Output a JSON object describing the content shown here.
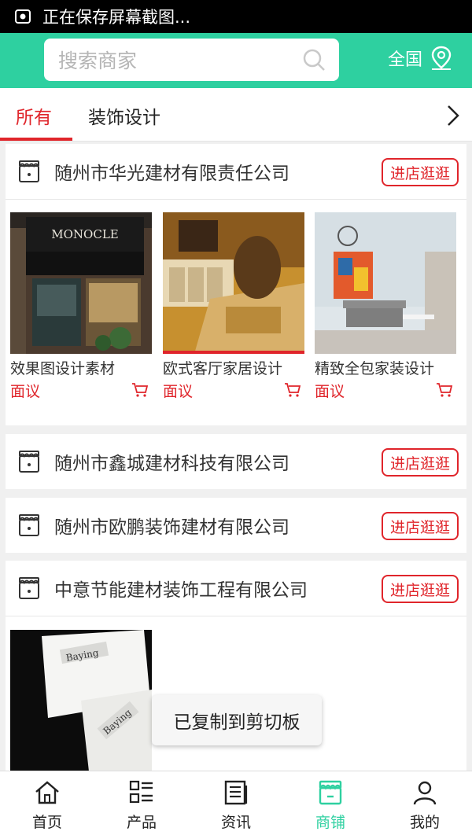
{
  "status_bar": {
    "text": "正在保存屏幕截图..."
  },
  "search": {
    "placeholder": "搜索商家"
  },
  "region": {
    "label": "全国"
  },
  "tabs": [
    {
      "label": "所有",
      "active": true
    },
    {
      "label": "装饰设计",
      "active": false
    }
  ],
  "shops": [
    {
      "name": "随州市华光建材有限责任公司",
      "visit_label": "进店逛逛",
      "products": [
        {
          "name": "效果图设计素材",
          "price": "面议",
          "image_text": "MONOCLE"
        },
        {
          "name": "欧式客厅家居设计",
          "price": "面议"
        },
        {
          "name": "精致全包家装设计",
          "price": "面议"
        }
      ]
    },
    {
      "name": "随州市鑫城建材科技有限公司",
      "visit_label": "进店逛逛"
    },
    {
      "name": "随州市欧鹏装饰建材有限公司",
      "visit_label": "进店逛逛"
    },
    {
      "name": "中意节能建材装饰工程有限公司",
      "visit_label": "进店逛逛",
      "products": [
        {
          "image_text": "Baying"
        }
      ]
    }
  ],
  "toast": {
    "text": "已复制到剪切板"
  },
  "nav": [
    {
      "label": "首页",
      "icon": "home-icon",
      "active": false
    },
    {
      "label": "产品",
      "icon": "grid-list-icon",
      "active": false
    },
    {
      "label": "资讯",
      "icon": "news-icon",
      "active": false
    },
    {
      "label": "商铺",
      "icon": "shop-icon",
      "active": true
    },
    {
      "label": "我的",
      "icon": "user-icon",
      "active": false
    }
  ],
  "colors": {
    "accent": "#2ed0a0",
    "price": "#e0252b",
    "active_tab": "#e0252b"
  }
}
